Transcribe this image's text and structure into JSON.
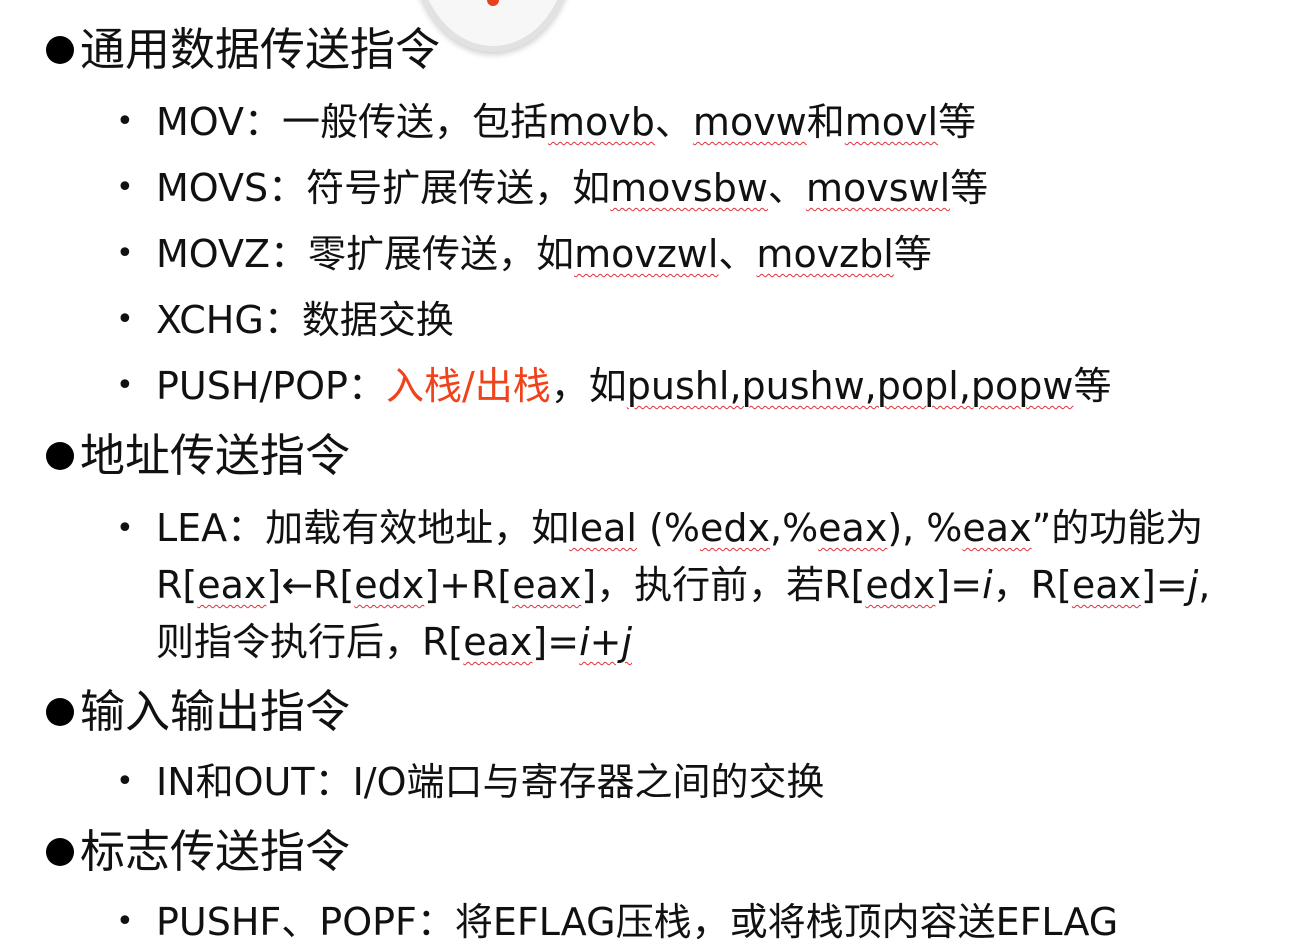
{
  "bullet": "•",
  "s1": {
    "title": "通用数据传送指令"
  },
  "mov": {
    "a": "MOV：一般传送，包括",
    "u1": "movb",
    "b": "、",
    "u2": "movw",
    "c": "和",
    "u3": "movl",
    "d": "等"
  },
  "movs": {
    "a": "MOVS：符号扩展传送，如",
    "u1": "movsbw",
    "b": "、",
    "u2": "movswl",
    "c": "等"
  },
  "movz": {
    "a": "MOVZ：零扩展传送，如",
    "u1": "movzwl",
    "b": "、",
    "u2": "movzbl",
    "c": "等"
  },
  "xchg": {
    "a": "XCHG：数据交换"
  },
  "push": {
    "a": "PUSH/POP：",
    "red": "入栈/出栈",
    "b": "，如",
    "u1": "pushl,pushw,popl,popw",
    "c": "等"
  },
  "s2": {
    "title": "地址传送指令"
  },
  "lea": {
    "l1a": "LEA：加载有效地址，如",
    "l1u1": "leal",
    "l1b": " (%",
    "l1u2": "edx",
    "l1c": ",%",
    "l1u3": "eax",
    "l1d": "), %",
    "l1u4": "eax",
    "l1e": "”的功能为",
    "l2a": "R[",
    "l2u1": "eax",
    "l2b": "]←R[",
    "l2u2": "edx",
    "l2c": "]+R[",
    "l2u3": "eax",
    "l2d": "]，执行前，若R[",
    "l2u4": "edx",
    "l2e": "]=",
    "l2i": "i",
    "l2f": "，R[",
    "l2u5": "eax",
    "l2g": "]=",
    "l2j": "j",
    "l2h": ",",
    "l3a": "则指令执行后，R[",
    "l3u1": "eax",
    "l3b": "]=",
    "l3expr": "i+j"
  },
  "s3": {
    "title": "输入输出指令"
  },
  "inout": {
    "a": "IN和OUT：I/O端口与寄存器之间的交换"
  },
  "s4": {
    "title": "标志传送指令"
  },
  "pushf": {
    "a": "PUSHF、POPF：将EFLAG压栈，或将栈顶内容送EFLAG"
  },
  "colors": {
    "accent": "#f0421b",
    "text": "#111111",
    "spellcheck": "#e0303a"
  }
}
